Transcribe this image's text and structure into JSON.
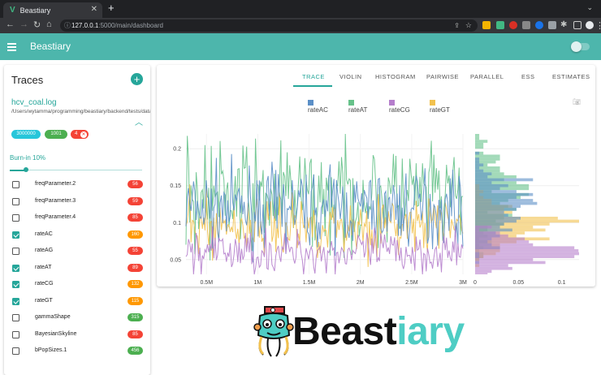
{
  "browser": {
    "tab_title": "Beastiary",
    "tab_icon": "V",
    "url_host": "127.0.0.1",
    "url_rest": ":5000/main/dashboard"
  },
  "app": {
    "title": "Beastiary",
    "colors": {
      "primary": "#4db6ac",
      "accent": "#26a69a"
    }
  },
  "traces": {
    "title": "Traces",
    "file_name": "hcv_coal.log",
    "file_path": "/Users/wytamma/programming/beastiary/backend/tests/data/hcv_coal.log",
    "chips": [
      {
        "label": "3000000",
        "color": "#26c6da"
      },
      {
        "label": "1001",
        "color": "#4caf50"
      },
      {
        "label": "4",
        "color": "#f44336"
      }
    ],
    "burnin_label": "Burn-in 10%",
    "burnin_fraction": 0.1,
    "params": [
      {
        "name": "freqParameter.2",
        "checked": false,
        "badge": "56",
        "badge_color": "#f44336"
      },
      {
        "name": "freqParameter.3",
        "checked": false,
        "badge": "59",
        "badge_color": "#f44336"
      },
      {
        "name": "freqParameter.4",
        "checked": false,
        "badge": "85",
        "badge_color": "#f44336"
      },
      {
        "name": "rateAC",
        "checked": true,
        "badge": "160",
        "badge_color": "#ff9800"
      },
      {
        "name": "rateAG",
        "checked": false,
        "badge": "55",
        "badge_color": "#f44336"
      },
      {
        "name": "rateAT",
        "checked": true,
        "badge": "89",
        "badge_color": "#f44336"
      },
      {
        "name": "rateCG",
        "checked": true,
        "badge": "132",
        "badge_color": "#ff9800"
      },
      {
        "name": "rateGT",
        "checked": true,
        "badge": "115",
        "badge_color": "#ff9800"
      },
      {
        "name": "gammaShape",
        "checked": false,
        "badge": "315",
        "badge_color": "#4caf50"
      },
      {
        "name": "BayesianSkyline",
        "checked": false,
        "badge": "85",
        "badge_color": "#f44336"
      },
      {
        "name": "bPopSizes.1",
        "checked": false,
        "badge": "456",
        "badge_color": "#4caf50"
      }
    ]
  },
  "tabs": [
    "TRACE",
    "VIOLIN",
    "HISTOGRAM",
    "PAIRWISE",
    "PARALLEL",
    "ESS",
    "ESTIMATES"
  ],
  "active_tab": "TRACE",
  "chart_data": [
    {
      "type": "line",
      "x_ticks": [
        "0.5M",
        "1M",
        "1.5M",
        "2M",
        "2.5M",
        "3M"
      ],
      "y_ticks": [
        "0.05",
        "0.1",
        "0.15",
        "0.2"
      ],
      "xlim": [
        300000,
        3000000
      ],
      "ylim": [
        0.03,
        0.22
      ],
      "series": [
        {
          "name": "rateAC",
          "color": "#5b8fc7",
          "mean": 0.12,
          "spread": 0.025
        },
        {
          "name": "rateAT",
          "color": "#66c28a",
          "mean": 0.135,
          "spread": 0.035
        },
        {
          "name": "rateCG",
          "color": "#b57ecc",
          "mean": 0.06,
          "spread": 0.015
        },
        {
          "name": "rateGT",
          "color": "#f2c14e",
          "mean": 0.095,
          "spread": 0.02
        }
      ]
    },
    {
      "type": "bar",
      "orientation": "horizontal",
      "x_ticks": [
        "0",
        "0.05",
        "0.1"
      ],
      "xlim": [
        0,
        0.12
      ],
      "ylim": [
        0.03,
        0.22
      ],
      "series": [
        "rateAC",
        "rateAT",
        "rateCG",
        "rateGT"
      ]
    }
  ]
}
